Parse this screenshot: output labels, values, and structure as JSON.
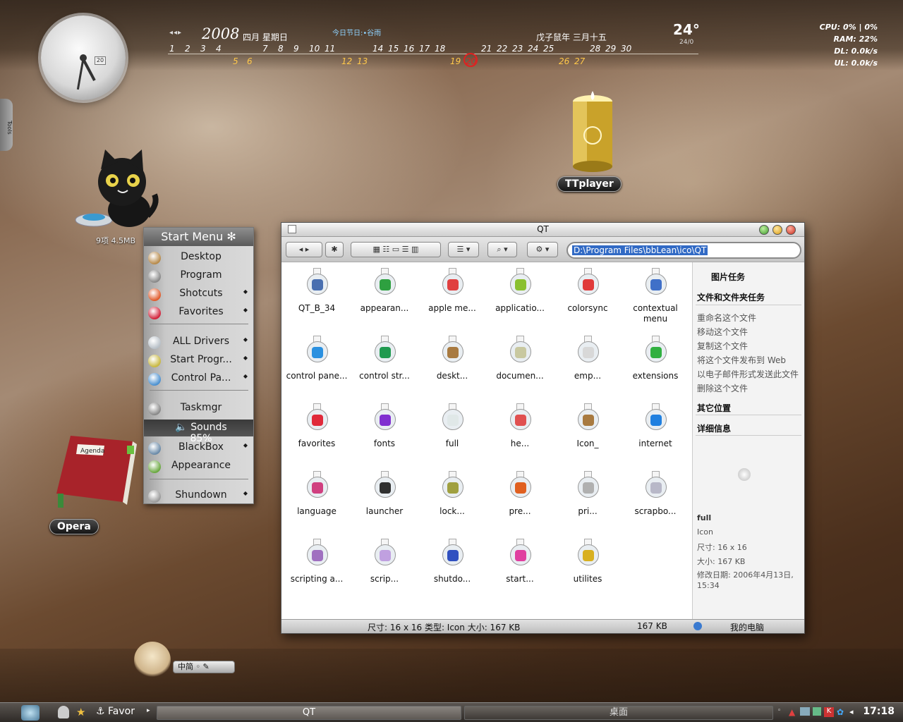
{
  "calendar": {
    "year": "2008",
    "month_weekday": "四月  星期日",
    "holiday": "今日节日:•谷雨",
    "lunar": "戊子鼠年  三月十五",
    "nav": "◂◂▸",
    "days_top": [
      "1",
      "2",
      "3",
      "4",
      "7",
      "8",
      "9",
      "10",
      "11",
      "14",
      "15",
      "16",
      "17",
      "18",
      "21",
      "22",
      "23",
      "24",
      "25",
      "28",
      "29",
      "30"
    ],
    "days_weekend": [
      "5",
      "6",
      "12",
      "13",
      "19",
      "20",
      "26",
      "27"
    ],
    "today": "20"
  },
  "weather": {
    "temp": "24°",
    "sub": "24/0"
  },
  "sysmon": {
    "cpu": "CPU: 0% | 0%",
    "ram": "RAM: 22%",
    "dl": "DL: 0.0k/s",
    "ul": "UL: 0.0k/s"
  },
  "clock": {
    "date": "20"
  },
  "tools": {
    "label": "Tools"
  },
  "desktop": {
    "cat_text": "9项 4.5MB",
    "ttplayer": "TTplayer",
    "opera": "Opera"
  },
  "startmenu": {
    "title": "Start Menu",
    "items": [
      {
        "label": "Desktop",
        "arrow": "",
        "color": "#b78a4a"
      },
      {
        "label": "Program",
        "arrow": "",
        "color": "#888"
      },
      {
        "label": "Shotcuts",
        "arrow": "◆",
        "color": "#e05a2a"
      },
      {
        "label": "Favorites",
        "arrow": "◆",
        "color": "#d2223a"
      },
      {
        "label": "ALL Drivers",
        "arrow": "◆",
        "color": "#b8c0c8"
      },
      {
        "label": "Start Progr...",
        "arrow": "◆",
        "color": "#c8b840"
      },
      {
        "label": "Control Pa...",
        "arrow": "◆",
        "color": "#4a90d0"
      },
      {
        "label": "Taskmgr",
        "arrow": "",
        "color": "#888"
      },
      {
        "label": "🔈 Sounds 85%",
        "arrow": "",
        "color": ""
      },
      {
        "label": "BlackBox",
        "arrow": "◆",
        "color": "#6a8aa8"
      },
      {
        "label": "Appearance",
        "arrow": "",
        "color": "#6aa840"
      },
      {
        "label": "Shundown",
        "arrow": "◆",
        "color": "#999"
      }
    ]
  },
  "window": {
    "title": "QT",
    "address": "D:\\Program Files\\bbLean\\ico\\QT",
    "toolbar": {
      "back": "◂  ▸",
      "views": "▦ ☷ ▭ ☰ ▥",
      "sort": "☰ ▾",
      "search": "⌕ ▾",
      "action": "⚙ ▾"
    },
    "files": [
      {
        "name": "QT_B_34",
        "color": "#4a6fb0"
      },
      {
        "name": "appearan...",
        "color": "#2ea040"
      },
      {
        "name": "apple me...",
        "color": "#e04040"
      },
      {
        "name": "applicatio...",
        "color": "#8ac030"
      },
      {
        "name": "colorsync",
        "color": "#e03a3a"
      },
      {
        "name": "contextual menu",
        "color": "#4070c8"
      },
      {
        "name": "control pane...",
        "color": "#2a90e0"
      },
      {
        "name": "control str...",
        "color": "#209a50"
      },
      {
        "name": "deskt...",
        "color": "#a87a40"
      },
      {
        "name": "documen...",
        "color": "#c8c8a0"
      },
      {
        "name": "emp...",
        "color": "#d8d8d8"
      },
      {
        "name": "extensions",
        "color": "#30b040"
      },
      {
        "name": "favorites",
        "color": "#e02a3a"
      },
      {
        "name": "fonts",
        "color": "#8030d0"
      },
      {
        "name": "full",
        "color": "#e0e8e8"
      },
      {
        "name": "he...",
        "color": "#e05050"
      },
      {
        "name": "Icon_",
        "color": "#a87a40"
      },
      {
        "name": "internet",
        "color": "#2080e0"
      },
      {
        "name": "language",
        "color": "#d04080"
      },
      {
        "name": "launcher",
        "color": "#303030"
      },
      {
        "name": "lock...",
        "color": "#a0a040"
      },
      {
        "name": "pre...",
        "color": "#e06020"
      },
      {
        "name": "pri...",
        "color": "#b0b0b0"
      },
      {
        "name": "scrapbo...",
        "color": "#b8b8c8"
      },
      {
        "name": "scripting a...",
        "color": "#a070c0"
      },
      {
        "name": "scrip...",
        "color": "#c0a0e0"
      },
      {
        "name": "shutdo...",
        "color": "#3050c0"
      },
      {
        "name": "start...",
        "color": "#e040a0"
      },
      {
        "name": "utilites",
        "color": "#d8b020"
      }
    ],
    "sidepanel": {
      "picture_tasks": "图片任务",
      "file_tasks": "文件和文件夹任务",
      "task_links": [
        "重命名这个文件",
        "移动这个文件",
        "复制这个文件",
        "将这个文件发布到 Web",
        "以电子邮件形式发送此文件",
        "删除这个文件"
      ],
      "other_places": "其它位置",
      "details": "详细信息",
      "detail_name": "full",
      "detail_type": "Icon",
      "detail_size_px": "尺寸: 16 x 16",
      "detail_size": "大小: 167 KB",
      "detail_modified": "修改日期: 2006年4月13日, 15:34"
    },
    "status": {
      "info": "尺寸: 16 x 16 类型: Icon 大小: 167 KB",
      "size": "167 KB",
      "location": "我的电脑"
    }
  },
  "avatar": {
    "text": "中简 ◦ ✎"
  },
  "taskbar": {
    "favor": "⚓ Favor",
    "task_qt": "QT",
    "desktop_label": "桌面",
    "time": "17:18"
  },
  "colors": {
    "accent": "#316ac5",
    "today_ring": "#e02020",
    "weekend": "#ffc84a"
  }
}
